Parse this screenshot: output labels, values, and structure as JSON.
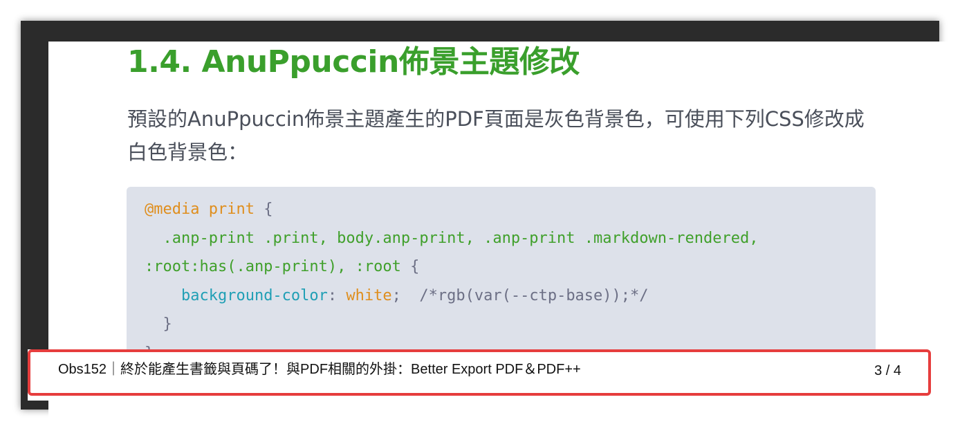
{
  "section": {
    "heading": "1.4. AnuPpuccin佈景主題修改",
    "paragraph": "預設的AnuPpuccin佈景主題產生的PDF頁面是灰色背景色，可使用下列CSS修改成白色背景色："
  },
  "code": {
    "line1": {
      "at_rule": "@media",
      "keyword": "print",
      "brace": "{"
    },
    "line2": {
      "selectors": ".anp-print .print, body.anp-print, .anp-print .markdown-rendered,"
    },
    "line3": {
      "selectors": ":root:has(.anp-print), :root",
      "brace": "{"
    },
    "line4": {
      "property": "background-color",
      "colon": ":",
      "value": "white",
      "semicolon": ";",
      "comment": "/*rgb(var(--ctp-base));*/"
    },
    "line5": {
      "brace": "}"
    },
    "line6": {
      "brace": "}"
    }
  },
  "footer": {
    "title": "Obs152｜終於能產生書籤與頁碼了！與PDF相關的外掛：Better Export PDF＆PDF++",
    "page_indicator": "3 / 4"
  },
  "colors": {
    "heading": "#3a9f2c",
    "highlight_border": "#e63d3d",
    "code_background": "#dde1ea"
  }
}
